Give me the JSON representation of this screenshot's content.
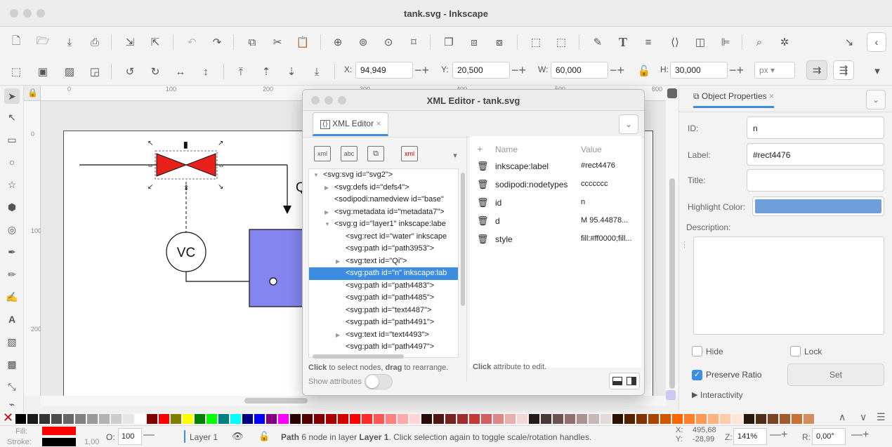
{
  "window": {
    "title": "tank.svg - Inkscape"
  },
  "toolbar": {
    "x_label": "X:",
    "x_value": "94,949",
    "y_label": "Y:",
    "y_value": "20,500",
    "w_label": "W:",
    "w_value": "60,000",
    "h_label": "H:",
    "h_value": "30,000",
    "unit": "px"
  },
  "rulers": {
    "h_ticks": [
      "0",
      "100",
      "200",
      "300",
      "400",
      "500",
      "600"
    ],
    "v_ticks": [
      "0",
      "100",
      "200"
    ]
  },
  "drawing": {
    "vc_label": "VC",
    "partial_text": "Q"
  },
  "xml_editor": {
    "title": "XML Editor - tank.svg",
    "tab_label": "XML Editor",
    "nodes": [
      {
        "text": "<svg:svg id=\"svg2\">",
        "arrow": "▼",
        "indent": 0
      },
      {
        "text": "<svg:defs id=\"defs4\">",
        "arrow": "▶",
        "indent": 1
      },
      {
        "text": "<sodipodi:namedview id=\"base\"",
        "arrow": "",
        "indent": 1
      },
      {
        "text": "<svg:metadata id=\"metadata7\">",
        "arrow": "▶",
        "indent": 1
      },
      {
        "text": "<svg:g id=\"layer1\" inkscape:labe",
        "arrow": "▼",
        "indent": 1
      },
      {
        "text": "<svg:rect id=\"water\" inkscape",
        "arrow": "",
        "indent": 2
      },
      {
        "text": "<svg:path id=\"path3953\">",
        "arrow": "",
        "indent": 2
      },
      {
        "text": "<svg:text id=\"Qi\">",
        "arrow": "▶",
        "indent": 2
      },
      {
        "text": "<svg:path id=\"n\" inkscape:lab",
        "arrow": "",
        "indent": 2,
        "selected": true
      },
      {
        "text": "<svg:path id=\"path4483\">",
        "arrow": "",
        "indent": 2
      },
      {
        "text": "<svg:path id=\"path4485\">",
        "arrow": "",
        "indent": 2
      },
      {
        "text": "<svg:path id=\"text4487\">",
        "arrow": "",
        "indent": 2
      },
      {
        "text": "<svg:path id=\"path4491\">",
        "arrow": "",
        "indent": 2
      },
      {
        "text": "<svg:text id=\"text4493\">",
        "arrow": "▶",
        "indent": 2
      },
      {
        "text": "<svg:path id=\"path4497\">",
        "arrow": "",
        "indent": 2
      }
    ],
    "attr_header_name": "Name",
    "attr_header_value": "Value",
    "attributes": [
      {
        "name": "inkscape:label",
        "value": "#rect4476"
      },
      {
        "name": "sodipodi:nodetypes",
        "value": "ccccccc"
      },
      {
        "name": "id",
        "value": "n"
      },
      {
        "name": "d",
        "value": "M 95.44878..."
      },
      {
        "name": "style",
        "value": "fill:#ff0000;fill..."
      }
    ],
    "hint_left_bold": "Click",
    "hint_left_rest": " to select nodes, ",
    "hint_left_bold2": "drag",
    "hint_left_rest2": " to rearrange.",
    "hint_right_bold": "Click",
    "hint_right_rest": " attribute to edit.",
    "show_attributes": "Show attributes"
  },
  "object_properties": {
    "tab_label": "Object Properties",
    "id_label": "ID:",
    "id_value": "n",
    "label_label": "Label:",
    "label_value": "#rect4476",
    "title_label": "Title:",
    "title_value": "",
    "highlight_label": "Highlight Color:",
    "highlight_color": "#6f9fd8",
    "description_label": "Description:",
    "hide_label": "Hide",
    "lock_label": "Lock",
    "preserve_label": "Preserve Ratio",
    "set_label": "Set",
    "interactivity_label": "Interactivity"
  },
  "palette_colors": [
    "#000000",
    "#1a1a1a",
    "#333333",
    "#4d4d4d",
    "#666666",
    "#808080",
    "#999999",
    "#b3b3b3",
    "#cccccc",
    "#e6e6e6",
    "#ffffff",
    "#800000",
    "#ff0000",
    "#808000",
    "#ffff00",
    "#008000",
    "#00ff00",
    "#008080",
    "#00ffff",
    "#000080",
    "#0000ff",
    "#800080",
    "#ff00ff",
    "#2b0000",
    "#550000",
    "#800000",
    "#aa0000",
    "#d40000",
    "#ff0000",
    "#ff2a2a",
    "#ff5555",
    "#ff8080",
    "#ffaaaa",
    "#ffd5d5",
    "#280b0b",
    "#501616",
    "#782121",
    "#a02c2c",
    "#c83737",
    "#d35f5f",
    "#de8787",
    "#e9afaf",
    "#f4d7d7",
    "#241c1c",
    "#483737",
    "#6c5353",
    "#916f6f",
    "#ac9393",
    "#c8b7b7",
    "#e3dbdb",
    "#2b1100",
    "#552200",
    "#803300",
    "#aa4400",
    "#d45500",
    "#ff6600",
    "#ff7f2a",
    "#ff9955",
    "#ffb380",
    "#ffccaa",
    "#ffe6d5",
    "#28170b",
    "#502d16",
    "#784421",
    "#a05a2c",
    "#c87137",
    "#d38d5f"
  ],
  "statusbar": {
    "fill_label": "Fill:",
    "stroke_label": "Stroke:",
    "fill_color": "#ff0000",
    "stroke_color": "#000000",
    "stroke_width": "1,00",
    "opacity_label": "O:",
    "opacity_value": "100",
    "layer_name": "Layer 1",
    "message_bold": "Path",
    "message_rest": " 6 node in layer ",
    "message_layer": "Layer 1",
    "message_tail": ". Click selection again to toggle scale/rotation handles.",
    "x_coord_label": "X:",
    "x_coord": "495,68",
    "y_coord_label": "Y:",
    "y_coord": "-28,99",
    "zoom_label": "Z:",
    "zoom": "141%",
    "rotation_label": "R:",
    "rotation": "0,00°"
  }
}
